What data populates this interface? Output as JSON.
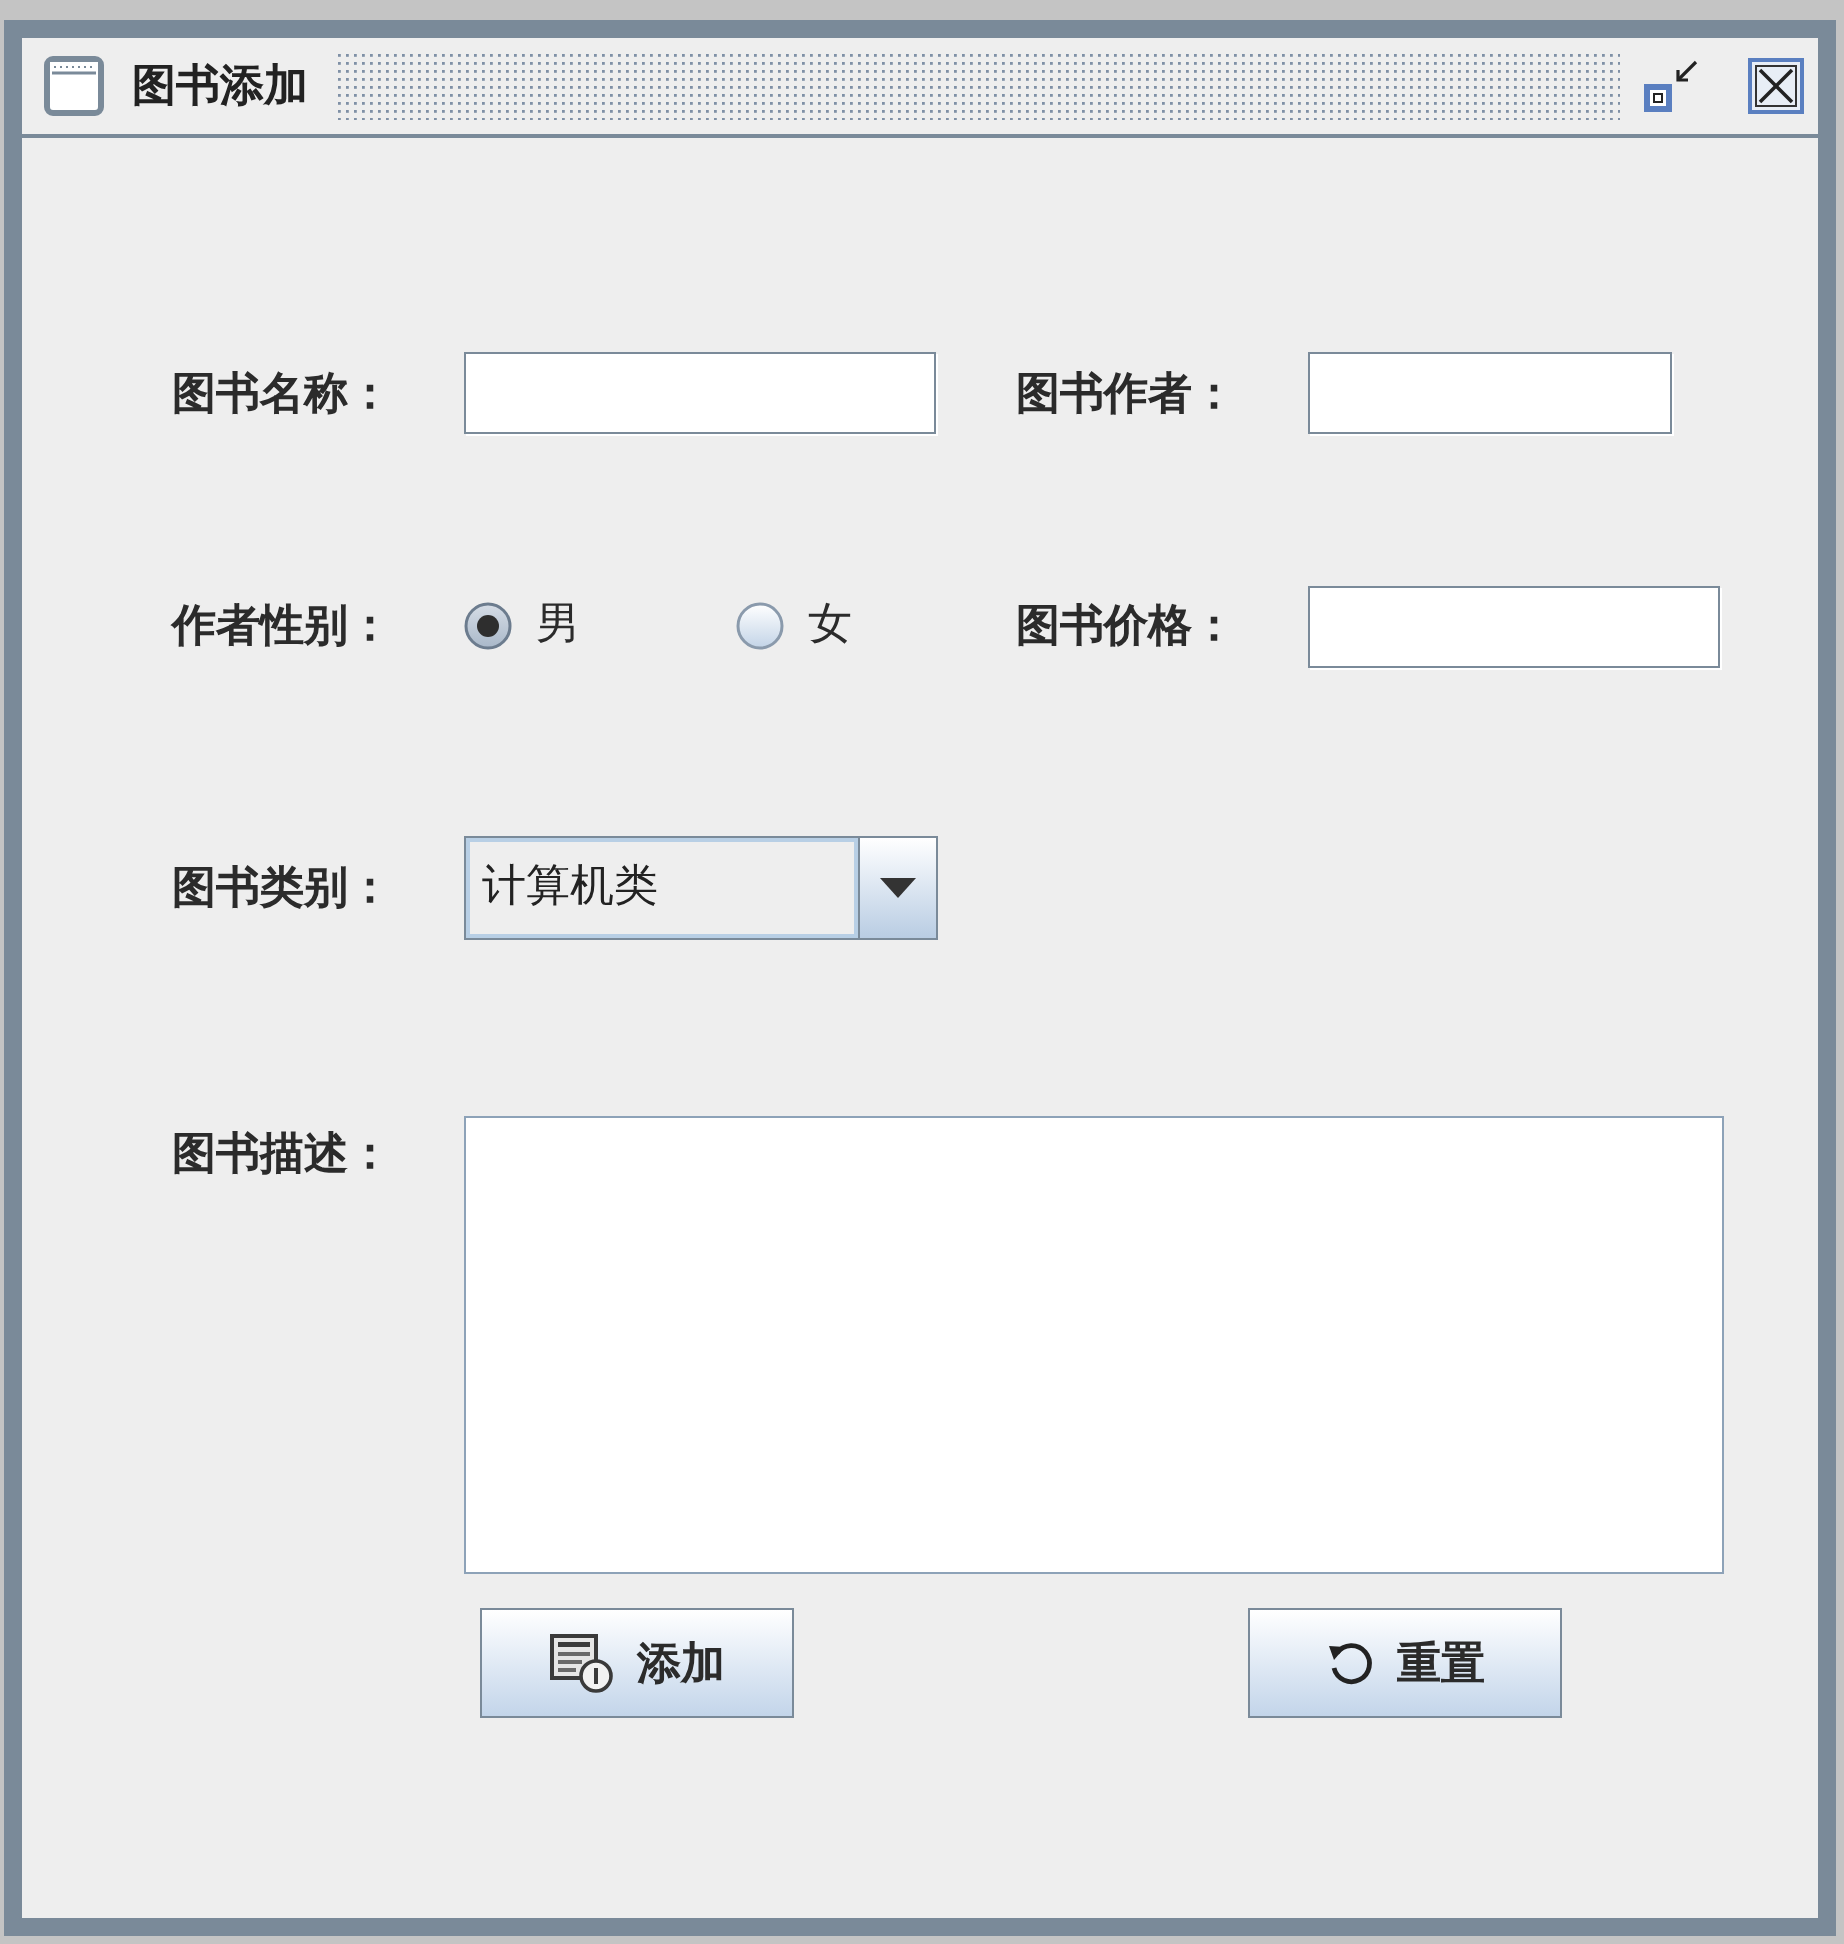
{
  "window": {
    "title": "图书添加"
  },
  "form": {
    "rows": [
      [
        {
          "kind": "text",
          "label": "图书名称："
        },
        {
          "kind": "text",
          "label": "图书作者："
        }
      ],
      [
        {
          "kind": "radio",
          "label": "作者性别：",
          "options": [
            {
              "label": "男",
              "selected": true
            },
            {
              "label": "女",
              "selected": false
            }
          ]
        },
        {
          "kind": "text",
          "label": "图书价格："
        }
      ],
      [
        {
          "kind": "select",
          "label": "图书类别：",
          "value": "计算机类"
        }
      ],
      [
        {
          "kind": "textarea",
          "label": "图书描述："
        }
      ]
    ]
  },
  "buttons": [
    {
      "kind": "add",
      "label": "添加"
    },
    {
      "kind": "reset",
      "label": "重置"
    }
  ]
}
